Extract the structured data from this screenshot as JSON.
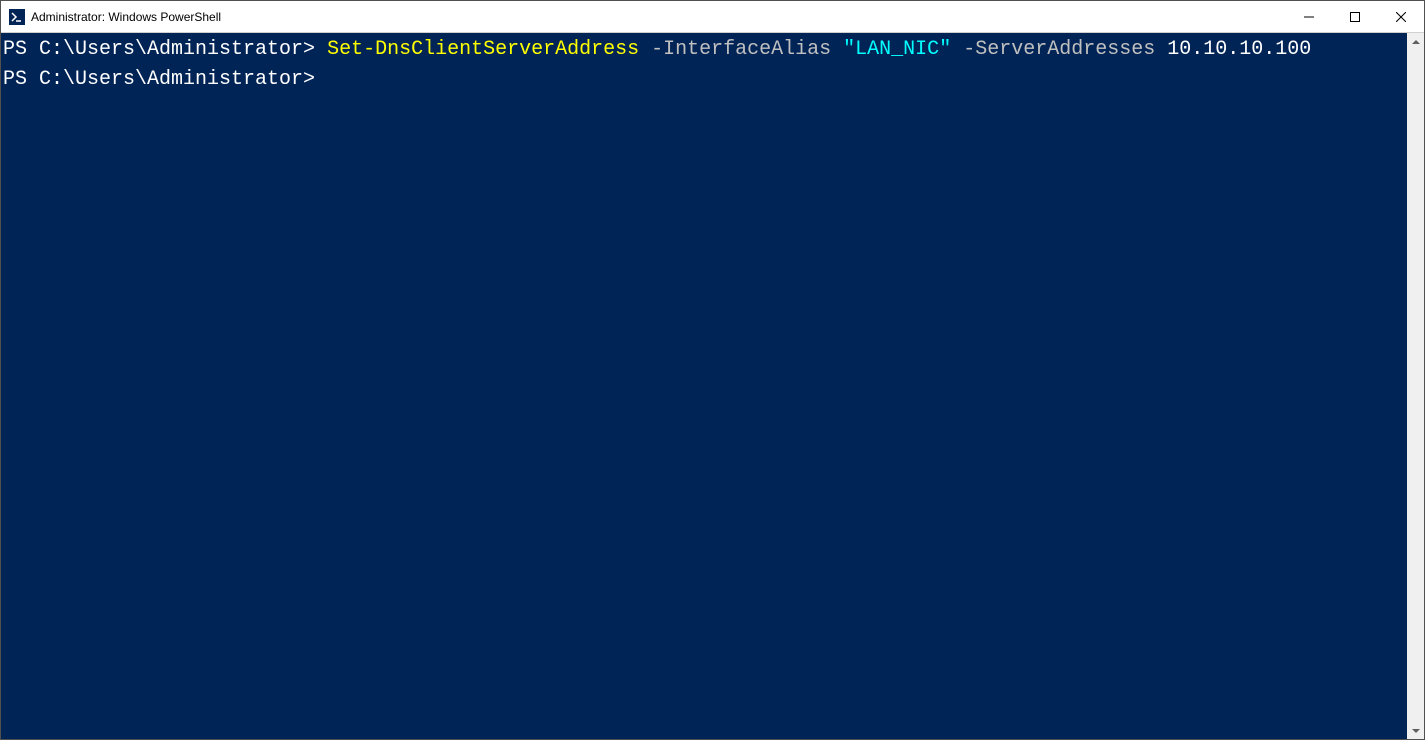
{
  "window": {
    "title": "Administrator: Windows PowerShell"
  },
  "terminal": {
    "lines": [
      {
        "prompt": "PS C:\\Users\\Administrator> ",
        "cmdlet": "Set-DnsClientServerAddress",
        "param1": " -InterfaceAlias ",
        "string1": "\"LAN_NIC\"",
        "param2": " -ServerAddresses ",
        "value": "10.10.10.100"
      },
      {
        "prompt": "PS C:\\Users\\Administrator>",
        "cmdlet": "",
        "param1": "",
        "string1": "",
        "param2": "",
        "value": ""
      }
    ]
  },
  "colors": {
    "terminalBg": "#012456",
    "promptColor": "#ffffff",
    "cmdletColor": "#ffff00",
    "paramColor": "#c0c0c0",
    "stringColor": "#00ffff"
  }
}
